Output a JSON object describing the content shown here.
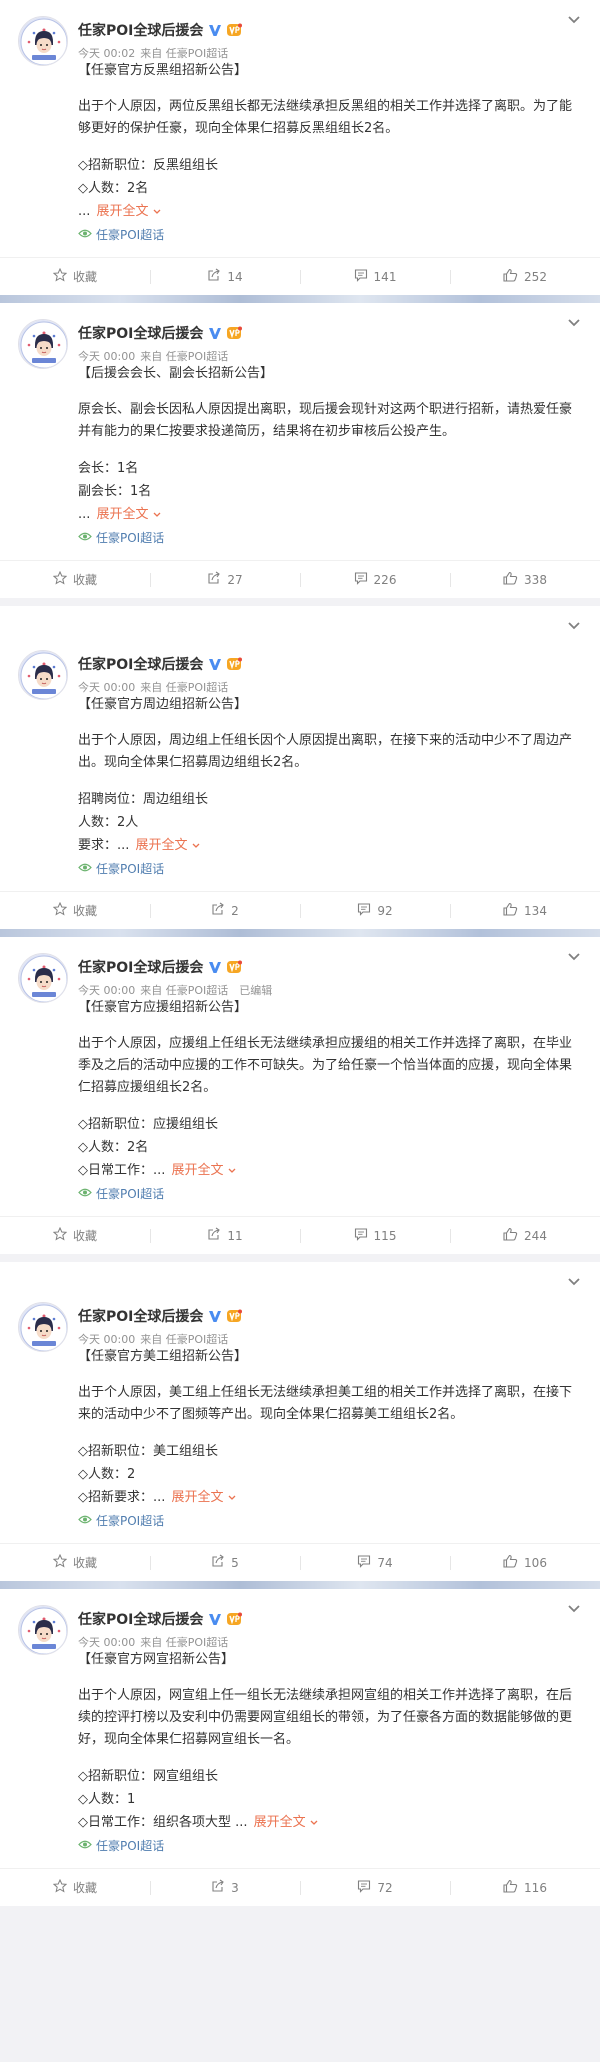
{
  "account": {
    "name": "任家POI全球后援会"
  },
  "labels": {
    "expand": "展开全文",
    "favorite": "收藏",
    "topic": "任豪POI超话",
    "edited": "已编辑"
  },
  "posts": [
    {
      "time": "今天 00:02",
      "source": "来自 任豪POI超话",
      "title": "【任豪官方反黑组招新公告】",
      "body": "出于个人原因，两位反黑组长都无法继续承担反黑组的相关工作并选择了离职。为了能够更好的保护任豪，现向全体果仁招募反黑组组长2名。",
      "lines": [
        "◇招新职位：反黑组组长",
        "◇人数：2名"
      ],
      "expand_prefix": "...",
      "reposts": "14",
      "comments": "141",
      "likes": "252"
    },
    {
      "time": "今天 00:00",
      "source": "来自 任豪POI超话",
      "title": "【后援会会长、副会长招新公告】",
      "body": "原会长、副会长因私人原因提出离职，现后援会现针对这两个职进行招新，请热爱任豪并有能力的果仁按要求投递简历，结果将在初步审核后公投产生。",
      "lines": [
        "会长：1名",
        "副会长：1名"
      ],
      "expand_prefix": "...",
      "reposts": "27",
      "comments": "226",
      "likes": "338"
    },
    {
      "time": "今天 00:00",
      "source": "来自 任豪POI超话",
      "title": "【任豪官方周边组招新公告】",
      "body": "出于个人原因，周边组上任组长因个人原因提出离职，在接下来的活动中少不了周边产出。现向全体果仁招募周边组组长2名。",
      "lines": [
        "招聘岗位：周边组组长",
        "人数：2人"
      ],
      "expand_prefix": "要求：...",
      "reposts": "2",
      "comments": "92",
      "likes": "134"
    },
    {
      "time": "今天 00:00",
      "source": "来自 任豪POI超话",
      "title": "【任豪官方应援组招新公告】",
      "body": "出于个人原因，应援组上任组长无法继续承担应援组的相关工作并选择了离职，在毕业季及之后的活动中应援的工作不可缺失。为了给任豪一个恰当体面的应援，现向全体果仁招募应援组组长2名。",
      "lines": [
        "◇招新职位：应援组组长",
        "◇人数：2名"
      ],
      "expand_prefix": "◇日常工作：...",
      "reposts": "11",
      "comments": "115",
      "likes": "244"
    },
    {
      "time": "今天 00:00",
      "source": "来自 任豪POI超话",
      "title": "【任豪官方美工组招新公告】",
      "body": "出于个人原因，美工组上任组长无法继续承担美工组的相关工作并选择了离职，在接下来的活动中少不了图频等产出。现向全体果仁招募美工组组长2名。",
      "lines": [
        "◇招新职位：美工组组长",
        "◇人数：2"
      ],
      "expand_prefix": "◇招新要求：...",
      "reposts": "5",
      "comments": "74",
      "likes": "106"
    },
    {
      "time": "今天 00:00",
      "source": "来自 任豪POI超话",
      "title": "【任豪官方网宣招新公告】",
      "body": "出于个人原因，网宣组上任一组长无法继续承担网宣组的相关工作并选择了离职，在后续的控评打榜以及安利中仍需要网宣组组长的带领，为了任豪各方面的数据能够做的更好，现向全体果仁招募网宣组长一名。",
      "lines": [
        "◇招新职位：网宣组组长",
        "◇人数：1"
      ],
      "expand_prefix": "◇日常工作：组织各项大型 ...",
      "reposts": "3",
      "comments": "72",
      "likes": "116"
    }
  ]
}
